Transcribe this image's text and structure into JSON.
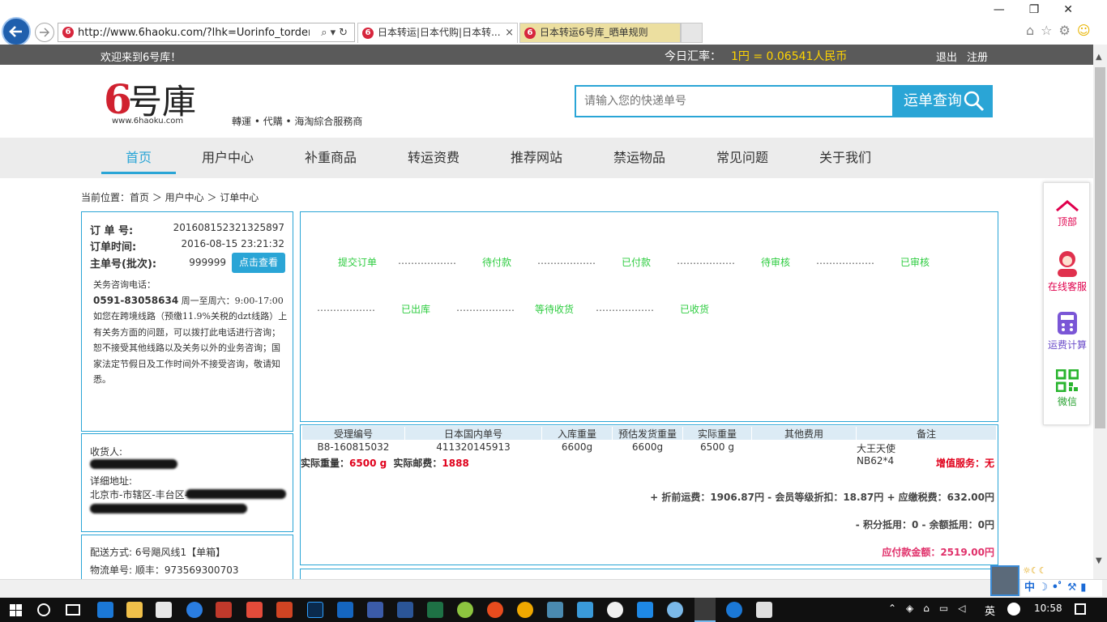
{
  "browser": {
    "url": "http://www.6haoku.com/?lhk=Uorinfo_torder&id=",
    "tabs": [
      {
        "title": "日本转运|日本代购|日本转...",
        "close": "×"
      },
      {
        "title": "日本转运6号库_晒单规则"
      }
    ],
    "favicon": "6"
  },
  "topbar": {
    "welcome": "欢迎来到6号库！",
    "rate_label": "今日汇率：",
    "rate_value": "1円 = 0.06541人民币",
    "logout": "退出",
    "register": "注册"
  },
  "header": {
    "logo_text": "6号庫",
    "logo_url": "www.6haoku.com",
    "slogan": "轉運 • 代購 • 海淘綜合服務商",
    "search_placeholder": "请输入您的快递单号",
    "search_button": "运单查询"
  },
  "nav": [
    "首页",
    "用户中心",
    "补重商品",
    "转运资费",
    "推荐网站",
    "禁运物品",
    "常见问题",
    "关于我们"
  ],
  "breadcrumb": "当前位置：首页 ＞ 用户中心 ＞ 订单中心",
  "order": {
    "no_label": "订 单 号:",
    "no": "201608152321325897",
    "time_label": "订单时间:",
    "time": "2016-08-15 23:21:32",
    "master_label": "主单号(批次):",
    "master": "999999",
    "check_button": "点击查看",
    "customs_title": "关务咨询电话：",
    "customs_phone": "0591-83058634",
    "customs_hours": " 周一至周六：9:00-17:00",
    "customs_text": "如您在跨境线路（预缴11.9%关税的dzt线路）上有关务方面的问题，可以拨打此电话进行咨询；恕不接受其他线路以及关务以外的业务咨询；国家法定节假日及工作时间外不接受咨询，敬请知悉。"
  },
  "receiver": {
    "label": "收货人:",
    "addr_label": "详细地址:",
    "addr_prefix": "北京市-市辖区-丰台区-"
  },
  "shipping": {
    "method": "配送方式: 6号飓风线1【单箱】",
    "tracking": "物流单号: 顺丰：973569300703"
  },
  "status_steps_row1": [
    "提交订单",
    "待付款",
    "已付款",
    "待审核",
    "已审核"
  ],
  "status_steps_row2": [
    "已出库",
    "等待收货",
    "已收货"
  ],
  "dots": "………………",
  "table": {
    "headers": [
      "受理编号",
      "日本国内单号",
      "入库重量",
      "预估发货重量",
      "实际重量",
      "其他费用",
      "备注"
    ],
    "row": [
      "B8-160815032",
      "411320145913",
      "6600g",
      "6600g",
      "6500 g",
      "",
      "大王天使NB62*4"
    ],
    "actual_weight_label": "实际重量：",
    "actual_weight": "6500 g",
    "actual_postage_label": "实际邮费：",
    "actual_postage": "1888",
    "value_added": "增值服务：无",
    "fee_line": "+ 折前运费：1906.87円 - 会员等级折扣：18.87円 + 应缴税费：632.00円",
    "credit_line": "- 积分抵用：0 - 余额抵用：0円",
    "total": "应付款金额：2519.00円"
  },
  "side": [
    "顶部",
    "在线客服",
    "运费计算",
    "微信"
  ],
  "taskbar": {
    "ime": "英",
    "time": "10:58"
  },
  "colors": {
    "accent": "#2aa5d6",
    "green": "#2ecc40",
    "red": "#e0001b",
    "pink": "#e0306a",
    "topbar": "#5a5a5a"
  }
}
